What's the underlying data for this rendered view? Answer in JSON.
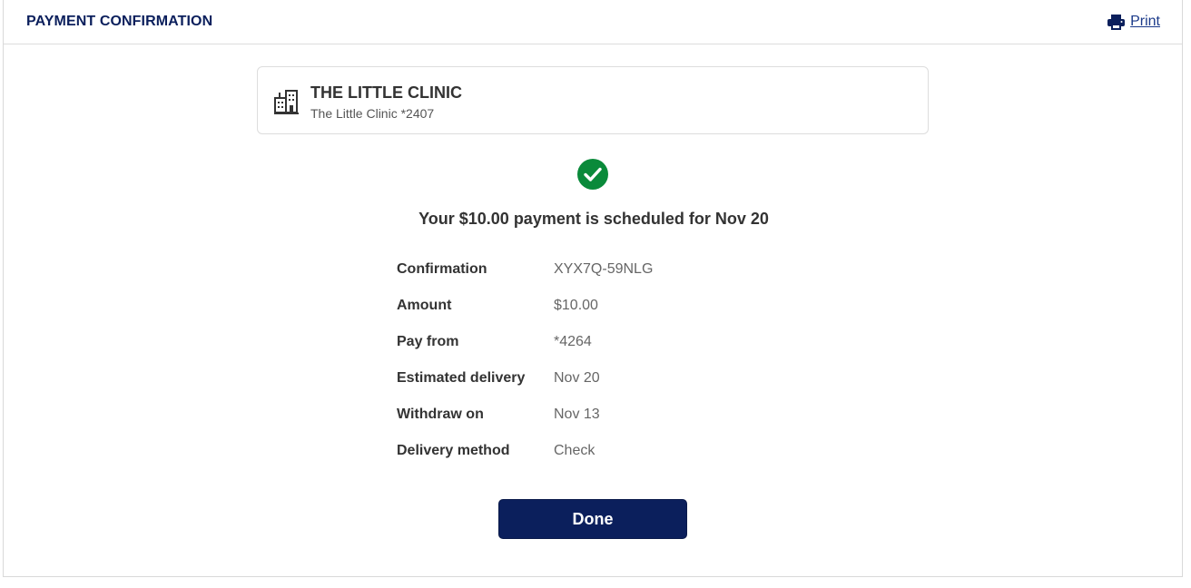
{
  "header": {
    "title": "PAYMENT CONFIRMATION",
    "print_label": "Print",
    "print_icon": "printer-icon"
  },
  "payee": {
    "icon": "building-icon",
    "name": "THE LITTLE CLINIC",
    "account": "The Little Clinic *2407"
  },
  "status": {
    "icon": "check-circle-icon",
    "icon_color": "#0a8a3a",
    "message": "Your $10.00 payment is scheduled for Nov 20"
  },
  "details": [
    {
      "label": "Confirmation",
      "value": "XYX7Q-59NLG"
    },
    {
      "label": "Amount",
      "value": "$10.00"
    },
    {
      "label": "Pay from",
      "value": "*4264"
    },
    {
      "label": "Estimated delivery",
      "value": "Nov 20"
    },
    {
      "label": "Withdraw on",
      "value": "Nov 13"
    },
    {
      "label": "Delivery method",
      "value": "Check"
    }
  ],
  "actions": {
    "done_label": "Done"
  },
  "colors": {
    "brand_navy": "#0b1f5c",
    "link_blue": "#1b3a8a",
    "success_green": "#0a8a3a"
  }
}
